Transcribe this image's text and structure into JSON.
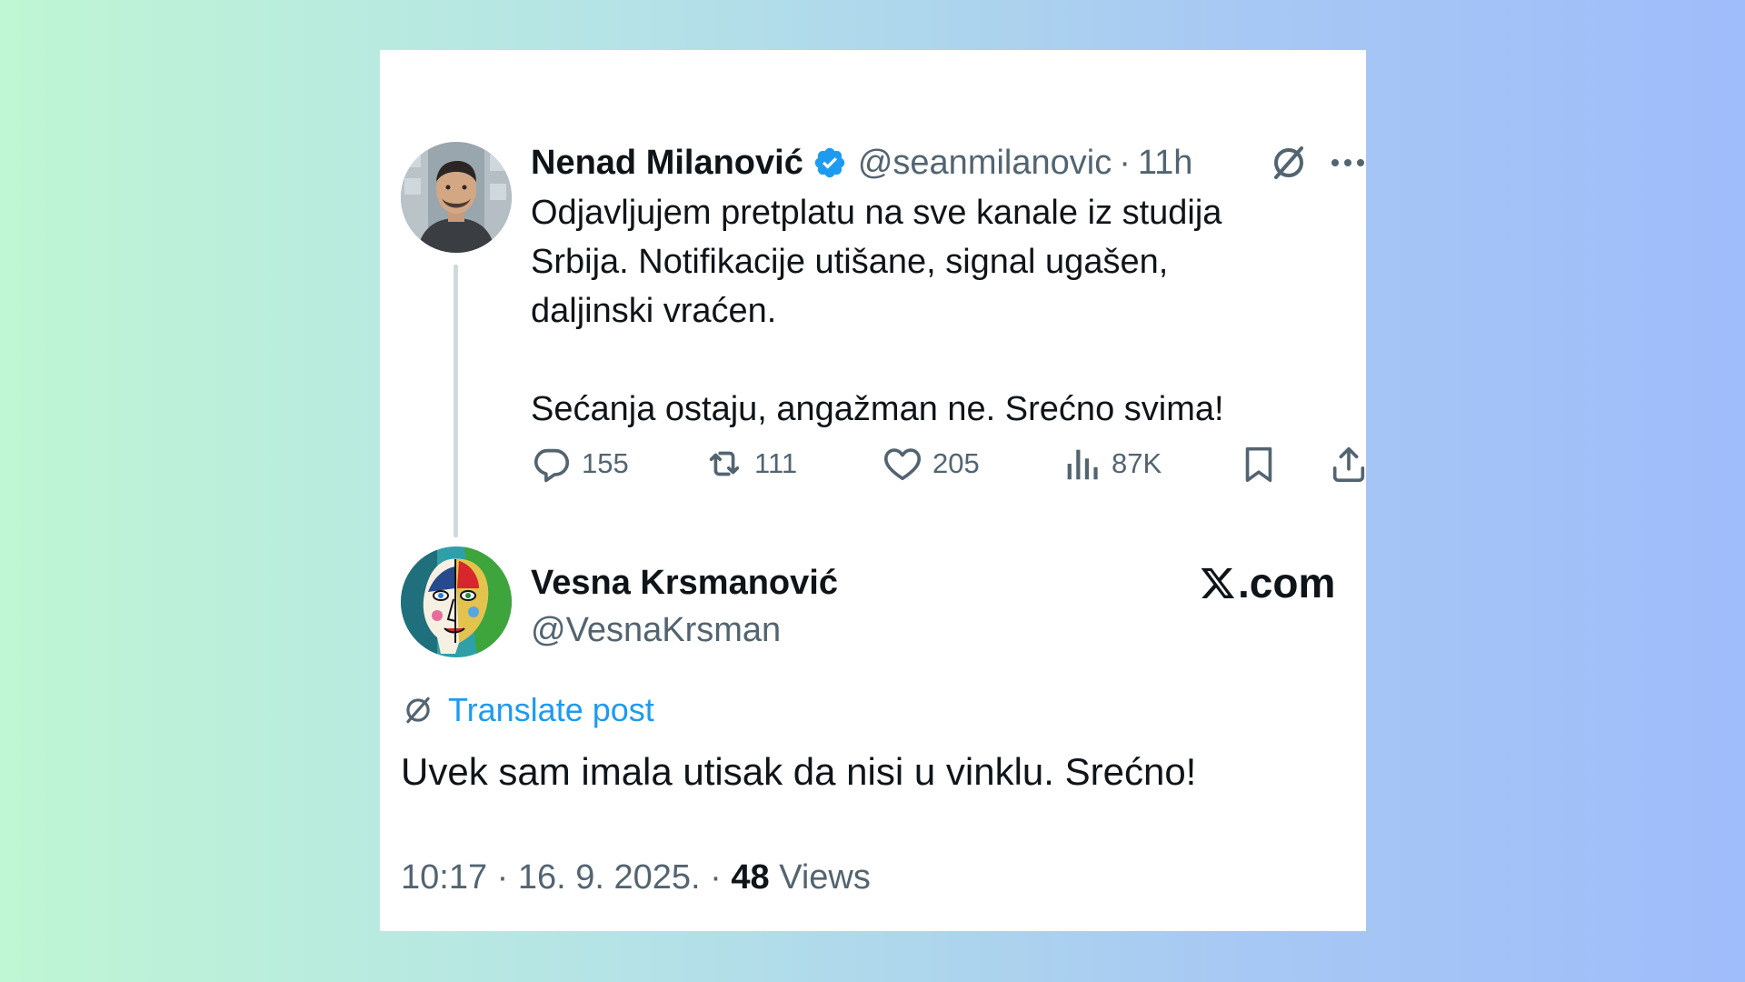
{
  "post": {
    "author_name": "Nenad Milanović",
    "handle": "@seanmilanovic",
    "separator": "·",
    "time": "11h",
    "text_lines": [
      "Odjavljujem pretplatu na sve kanale iz studija",
      "Srbija. Notifikacije utišane, signal ugašen,",
      "daljinski vraćen."
    ],
    "text_line_last": "Sećanja ostaju, angažman ne. Srećno svima!",
    "actions": {
      "replies": "155",
      "reposts": "111",
      "likes": "205",
      "views": "87K"
    }
  },
  "reply": {
    "author_name": "Vesna Krsmanović",
    "handle": "@VesnaKrsman",
    "brand": ".com",
    "translate_label": "Translate post",
    "text": "Uvek sam imala utisak da nisi u vinklu. Srećno!",
    "timestamp": "10:17 · 16. 9. 2025. · ",
    "views_count": "48",
    "views_label": " Views"
  },
  "icons": {
    "verified": "verified-badge-icon",
    "translate": "translate-icon",
    "more": "more-icon",
    "reply": "reply-icon",
    "repost": "repost-icon",
    "like": "like-icon",
    "views": "views-icon",
    "bookmark": "bookmark-icon",
    "share": "share-icon",
    "x_logo": "x-logo-icon"
  },
  "colors": {
    "accent": "#1d9bf0",
    "text": "#0f1419",
    "muted": "#536471",
    "thread_line": "#cfd9de"
  }
}
